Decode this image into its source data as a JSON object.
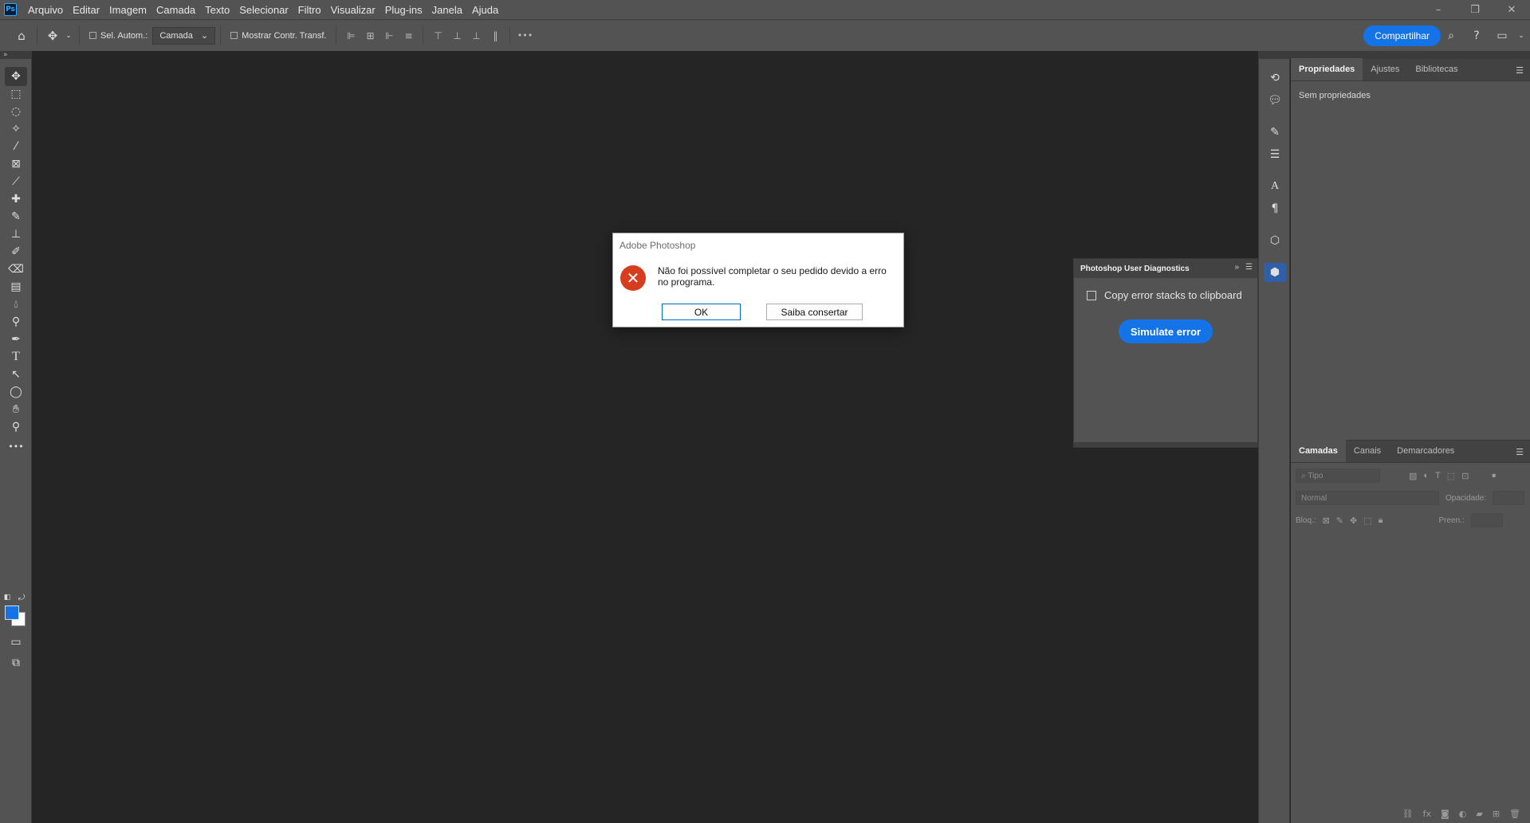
{
  "app": {
    "logo": "Ps",
    "icon": "photoshop-logo-icon"
  },
  "menu": [
    "Arquivo",
    "Editar",
    "Imagem",
    "Camada",
    "Texto",
    "Selecionar",
    "Filtro",
    "Visualizar",
    "Plug-ins",
    "Janela",
    "Ajuda"
  ],
  "window_controls": {
    "minimize": "–",
    "restore": "❐",
    "close": "✕"
  },
  "options": {
    "auto_select_label": "Sel. Autom.:",
    "target_select": "Camada",
    "show_transform_label": "Mostrar Contr. Transf.",
    "more": "•••",
    "share_label": "Compartilhar"
  },
  "toolbar": {
    "tools": [
      "move-tool",
      "marquee-tool",
      "lasso-tool",
      "magic-wand-tool",
      "pen-tool",
      "frame-tool",
      "eyedropper-tool",
      "healing-brush-tool",
      "brush-tool",
      "clone-stamp-tool",
      "history-brush-tool",
      "eraser-tool",
      "gradient-tool",
      "blur-tool",
      "dodge-tool",
      "pen-path-tool",
      "type-tool",
      "path-selection-tool",
      "ellipse-tool",
      "hand-tool",
      "zoom-tool",
      "more-tools"
    ],
    "foreground_color": "#1473e6",
    "background_color": "#ffffff"
  },
  "properties_panel": {
    "tabs": [
      "Propriedades",
      "Ajustes",
      "Bibliotecas"
    ],
    "active_tab": "Propriedades",
    "body": "Sem propriedades"
  },
  "layers_panel": {
    "tabs": [
      "Camadas",
      "Canais",
      "Demarcadores"
    ],
    "active_tab": "Camadas",
    "filter_placeholder": "Tipo",
    "blend_mode": "Normal",
    "opacity_label": "Opacidade:",
    "lock_label": "Bloq.:",
    "fill_label": "Preen.:"
  },
  "diagnostics_panel": {
    "title": "Photoshop User Diagnostics",
    "checkbox_label": "Copy error stacks to clipboard",
    "button_label": "Simulate error"
  },
  "dialog": {
    "title": "Adobe Photoshop",
    "message": "Não foi possível completar o seu pedido devido a erro no programa.",
    "ok_label": "OK",
    "help_label": "Saiba consertar",
    "icon": "error-icon"
  }
}
